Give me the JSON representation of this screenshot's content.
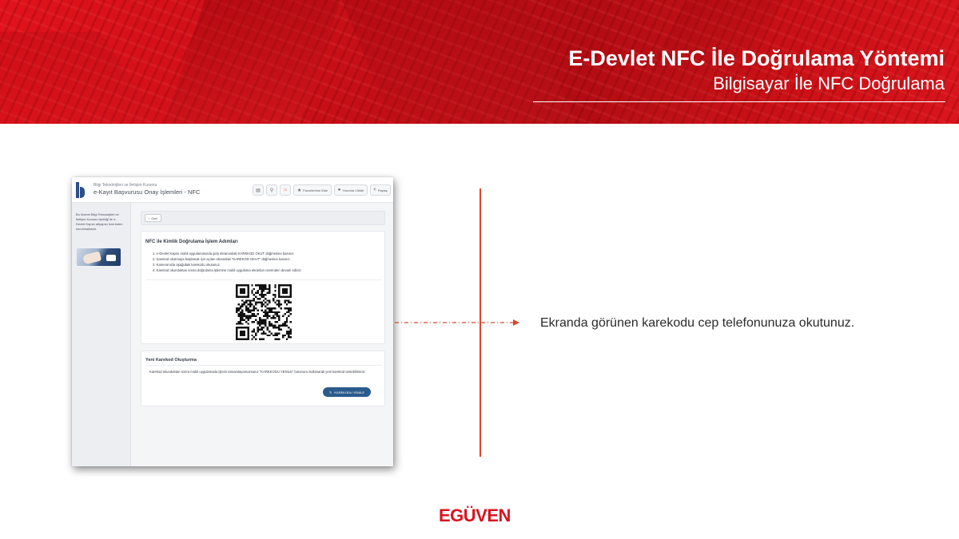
{
  "header": {
    "title": "E-Devlet NFC İle Doğrulama Yöntemi",
    "subtitle": "Bilgisayar İle NFC Doğrulama"
  },
  "screenshot": {
    "org_name": "Bilgi Teknolojileri ve İletişim Kurumu",
    "page_title": "e-Kayıt Başvurusu Onay İşlemleri - NFC",
    "toolbar": {
      "favorites_label": "Favorilerime Ekle",
      "feedback_label": "Yorumla / Bildir",
      "share_label": "Paylaş"
    },
    "sidebar_text": "Bu hizmet Bilgi Teknolojileri ve İletişim Kurumu işbirliği ile e-Devlet Kapısı altyapısı üzerinden sunulmaktadır.",
    "back_label": "Geri",
    "nfc_title": "NFC ile Kimlik Doğrulama İşlem Adımları",
    "steps": [
      "1. e-Devlet Kapısı mobil uygulamasında giriş ekranındaki KAREKOD OKUT düğmesine basınız.",
      "2. Karekod okutmaya başlamak için açılan ekrandaki \"KAREKOD OKUT\" düğmesine basınız.",
      "3. Kameranızla aşağıdaki karekodu okutunuz.",
      "4. Karekod okunduktan sonra doğrulama işlemine mobil uygulama ekranları üzerinden devam ediniz."
    ],
    "new_qr_title": "Yeni Karekod Oluşturma",
    "new_qr_text": "Karekod okunduktan sonra mobil uygulamada işlemi tamamlayamazsanız \"KAREKODU YENİLE\" butonunu kullanarak yeni karekod üretebilirsiniz.",
    "renew_button_label": "KAREKODU YENİLE"
  },
  "caption": "Ekranda görünen karekodu cep telefonunuza okutunuz.",
  "brand": "EGÜVEN",
  "colors": {
    "banner_red": "#c80f17",
    "accent_line": "#d9472f",
    "brand_red": "#d7141f",
    "button_blue": "#2a5b8c"
  }
}
